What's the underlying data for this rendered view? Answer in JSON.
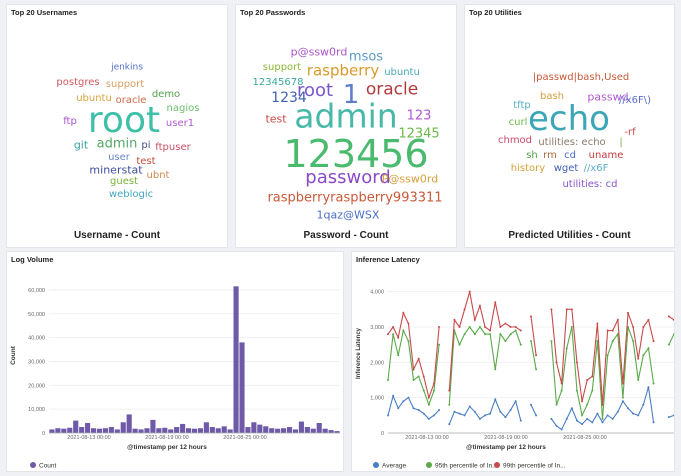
{
  "panels": {
    "usernames": {
      "title": "Top 20 Usernames",
      "caption": "Username - Count",
      "words": [
        {
          "text": "jenkins",
          "color": "#5470c6"
        },
        {
          "text": "postgres",
          "color": "#d0585e"
        },
        {
          "text": "support",
          "color": "#d6a062"
        },
        {
          "text": "demo",
          "color": "#54a24b"
        },
        {
          "text": "ubuntu",
          "color": "#d8a23a"
        },
        {
          "text": "oracle",
          "color": "#d06a4c"
        },
        {
          "text": "nagios",
          "color": "#6bbd6b"
        },
        {
          "text": "root",
          "color": "#3dbfa8"
        },
        {
          "text": "ftp",
          "color": "#a855c8"
        },
        {
          "text": "user1",
          "color": "#b05ad0"
        },
        {
          "text": "git",
          "color": "#3aa6a0"
        },
        {
          "text": "admin",
          "color": "#54a76a"
        },
        {
          "text": "pi",
          "color": "#444c88"
        },
        {
          "text": "ftpuser",
          "color": "#c94f6a"
        },
        {
          "text": "user",
          "color": "#6b86c8"
        },
        {
          "text": "test",
          "color": "#c44d3a"
        },
        {
          "text": "minerstat",
          "color": "#3e4f9a"
        },
        {
          "text": "ubnt",
          "color": "#d08a4a"
        },
        {
          "text": "guest",
          "color": "#7ab23a"
        },
        {
          "text": "weblogic",
          "color": "#46a6c4"
        }
      ]
    },
    "passwords": {
      "title": "Top 20 Passwords",
      "caption": "Password - Count",
      "words": [
        {
          "text": "p@ssw0rd",
          "color": "#a855c8"
        },
        {
          "text": "msos",
          "color": "#5a9ac8"
        },
        {
          "text": "support",
          "color": "#8ab83a"
        },
        {
          "text": "raspberry",
          "color": "#d99a2a"
        },
        {
          "text": "ubuntu",
          "color": "#4aa6b6"
        },
        {
          "text": "12345678",
          "color": "#3aa6a0"
        },
        {
          "text": "root",
          "color": "#7a55c8"
        },
        {
          "text": "1",
          "color": "#5a7ec8"
        },
        {
          "text": "oracle",
          "color": "#b23a3a"
        },
        {
          "text": "1234",
          "color": "#3e5fb2"
        },
        {
          "text": "admin",
          "color": "#48b8a8"
        },
        {
          "text": "test",
          "color": "#c84a4a"
        },
        {
          "text": "123",
          "color": "#b05ad0"
        },
        {
          "text": "12345",
          "color": "#6bb84a"
        },
        {
          "text": "123456",
          "color": "#4aba6e"
        },
        {
          "text": "password",
          "color": "#8a4ac8"
        },
        {
          "text": "P@ssw0rd",
          "color": "#d6a03a"
        },
        {
          "text": "raspberryraspberry993311",
          "color": "#c85a3a"
        },
        {
          "text": "1qaz@WSX",
          "color": "#4a6ec8"
        }
      ]
    },
    "utilities": {
      "title": "Top 20 Utilities",
      "caption": "Predicted Utilities - Count",
      "words": [
        {
          "text": "|passwd|bash,Used",
          "color": "#c85a3a"
        },
        {
          "text": "bash",
          "color": "#d6a03a"
        },
        {
          "text": "passwd",
          "color": "#b05ad0"
        },
        {
          "text": "tftp",
          "color": "#5ab0c8"
        },
        {
          "text": "//x6F\\)",
          "color": "#5a6ec8"
        },
        {
          "text": "echo",
          "color": "#3aa6b6"
        },
        {
          "text": "curl",
          "color": "#6bb84a"
        },
        {
          "text": "-rf",
          "color": "#c84a4a"
        },
        {
          "text": "chmod",
          "color": "#c84a6a"
        },
        {
          "text": "utilities: echo",
          "color": "#8a7a6a"
        },
        {
          "text": "|",
          "color": "#7ab23a"
        },
        {
          "text": "sh",
          "color": "#54a24b"
        },
        {
          "text": "rm",
          "color": "#a86a3a"
        },
        {
          "text": "cd",
          "color": "#4a6ec8"
        },
        {
          "text": "uname",
          "color": "#c83a3a"
        },
        {
          "text": "history",
          "color": "#d6a03a"
        },
        {
          "text": "wget",
          "color": "#3e5fb2"
        },
        {
          "text": "//x6F",
          "color": "#5ab0c8"
        },
        {
          "text": "utilities: cd",
          "color": "#8a55c8"
        }
      ]
    },
    "logvolume": {
      "title": "Log Volume",
      "legend": "Count",
      "color": "#6e5aa8"
    },
    "latency": {
      "title": "Inference Latency",
      "legend": [
        {
          "label": "Average",
          "color": "#4a7ec4"
        },
        {
          "label": "95th percentile of In...",
          "color": "#5aaa4a"
        },
        {
          "label": "99th percentile of In...",
          "color": "#c84a4a"
        }
      ]
    }
  },
  "chart_data": [
    {
      "type": "bar",
      "title": "Log Volume",
      "xlabel": "@timestamp per 12 hours",
      "ylabel": "Count",
      "ylim": [
        0,
        65000
      ],
      "yticks": [
        "0",
        "10,000",
        "20,000",
        "30,000",
        "40,000",
        "50,000",
        "60,000"
      ],
      "xticks": [
        "2021-08-13 00:00",
        "2021-08-19 00:00",
        "2021-08-25 00:00"
      ],
      "values": [
        1500,
        2000,
        1800,
        2200,
        5200,
        2500,
        4200,
        2000,
        1800,
        2000,
        2500,
        1500,
        4500,
        7800,
        1800,
        1500,
        2000,
        5500,
        2000,
        2200,
        1500,
        2500,
        3800,
        2000,
        1800,
        2000,
        4500,
        2500,
        2000,
        2800,
        1500,
        61500,
        38000,
        2500,
        4500,
        3500,
        2800,
        2000,
        1800,
        2000,
        2500,
        1500,
        4800,
        2500,
        1800,
        4200,
        1800,
        1200,
        800
      ],
      "legend": [
        "Count"
      ],
      "grid": true
    },
    {
      "type": "line",
      "title": "Inference Latency",
      "xlabel": "@timestamp per 12 hours",
      "ylabel": "Inference Latency",
      "ylim": [
        0,
        4500
      ],
      "yticks": [
        "0",
        "1,000",
        "2,000",
        "3,000",
        "4,000"
      ],
      "xticks": [
        "2021-08-13 00:00",
        "2021-08-19 00:00",
        "2021-08-25 00:00"
      ],
      "series": [
        {
          "name": "Average",
          "color": "#4a7ec4",
          "values": [
            500,
            1050,
            700,
            900,
            1000,
            700,
            650,
            550,
            400,
            500,
            650,
            null,
            250,
            600,
            550,
            500,
            750,
            600,
            400,
            500,
            550,
            950,
            600,
            450,
            650,
            900,
            350,
            null,
            800,
            500,
            null,
            null,
            400,
            200,
            100,
            400,
            700,
            350,
            250,
            400,
            300,
            550,
            300,
            500,
            400,
            600,
            900,
            700,
            550,
            500,
            800,
            1300,
            300,
            null,
            null,
            450,
            500
          ]
        },
        {
          "name": "95th percentile of In...",
          "color": "#5aaa4a",
          "values": [
            1500,
            2800,
            2200,
            2900,
            2600,
            1500,
            1600,
            1200,
            800,
            1200,
            2500,
            null,
            800,
            2900,
            2500,
            2800,
            3000,
            2800,
            3000,
            2800,
            2800,
            1800,
            2800,
            2600,
            2800,
            2900,
            2500,
            null,
            2600,
            1800,
            null,
            null,
            2600,
            800,
            1200,
            2400,
            3000,
            1200,
            500,
            800,
            1200,
            2600,
            400,
            2200,
            2600,
            2800,
            1000,
            3000,
            2600,
            1500,
            2200,
            2400,
            1400,
            null,
            null,
            2500,
            2800
          ]
        },
        {
          "name": "99th percentile of In...",
          "color": "#c84a4a",
          "values": [
            2800,
            3000,
            2700,
            3400,
            3100,
            1800,
            2100,
            1600,
            1000,
            1400,
            3000,
            null,
            1200,
            3200,
            3000,
            3500,
            4000,
            3200,
            3600,
            3000,
            2900,
            3700,
            3000,
            3100,
            3000,
            3000,
            2900,
            null,
            3300,
            2200,
            null,
            null,
            3500,
            2000,
            1400,
            3500,
            3500,
            2000,
            900,
            1500,
            1600,
            3100,
            800,
            2900,
            2900,
            3200,
            1400,
            3400,
            3000,
            2100,
            3000,
            3200,
            2600,
            null,
            null,
            3300,
            3200
          ]
        }
      ],
      "legend_position": "bottom-left",
      "grid": true
    }
  ]
}
